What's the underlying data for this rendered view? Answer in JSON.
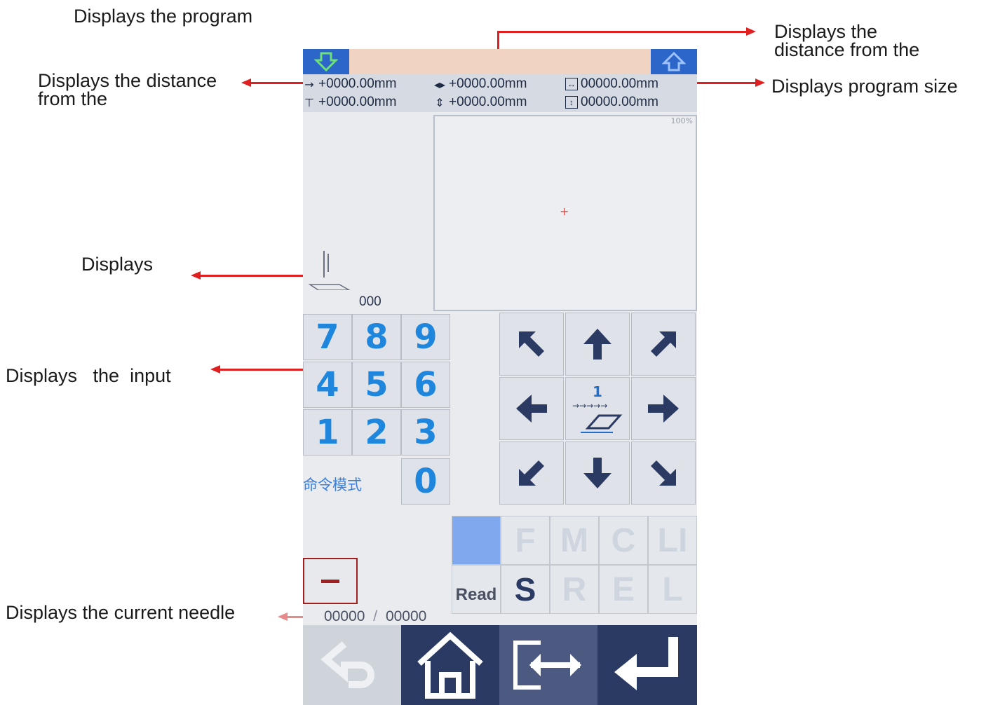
{
  "annotations": {
    "program": "Displays the program",
    "distance_right_line1": "Displays the",
    "distance_right_line2": "distance from the",
    "distance_left_line1": "Displays the distance",
    "distance_left_line2": "from the",
    "program_size": "Displays program size",
    "displays": "Displays",
    "input": "Displays   the  input",
    "current_needle": "Displays the current needle"
  },
  "coords": {
    "x_from_origin": "+0000.00mm",
    "y_from_origin": "+0000.00mm",
    "x_distance": "+0000.00mm",
    "y_distance": "+0000.00mm",
    "width": "00000.00mm",
    "height": "00000.00mm"
  },
  "preview": {
    "zoom": "100%"
  },
  "stitch_count": "000",
  "keypad": {
    "k7": "7",
    "k8": "8",
    "k9": "9",
    "k4": "4",
    "k5": "5",
    "k6": "6",
    "k1": "1",
    "k2": "2",
    "k3": "3",
    "k0": "0",
    "command_mode": "命令模式"
  },
  "dpad": {
    "step": "1"
  },
  "function_keys": {
    "f": "F",
    "m": "M",
    "c": "C",
    "li": "LI",
    "read": "Read",
    "s": "S",
    "r": "R",
    "e": "E",
    "l": "L"
  },
  "needle": {
    "current": "00000",
    "separator": "/",
    "total": "00000"
  },
  "colors": {
    "accent": "#2c66c9",
    "key_digit": "#1f86dd",
    "nav_dark": "#2b3a63",
    "annotation_arrow": "#e02020"
  },
  "icons": {
    "download": "down-arrow-icon",
    "upload": "up-arrow-icon",
    "needle": "needle-icon",
    "home": "home-icon",
    "transfer": "transfer-icon",
    "enter": "enter-icon",
    "back": "back-icon"
  }
}
